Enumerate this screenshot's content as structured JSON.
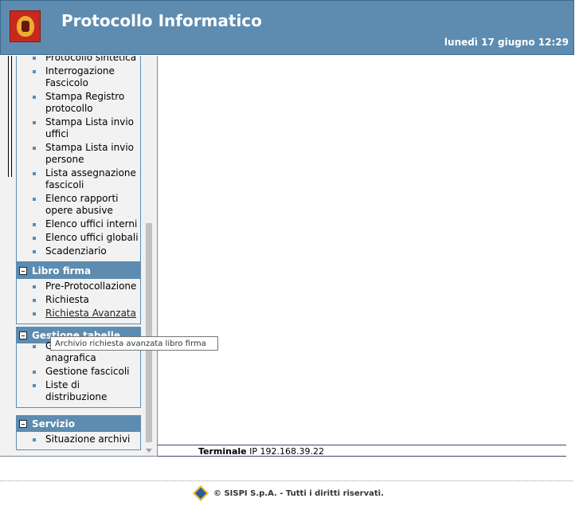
{
  "header": {
    "title": "Protocollo Informatico",
    "datetime": "lunedì 17 giugno 12:29"
  },
  "sidebar": {
    "sections": [
      {
        "title": "",
        "items": [
          {
            "label": "Protocollo sintetica"
          },
          {
            "label": "Interrogazione Fascicolo"
          },
          {
            "label": "Stampa Registro protocollo"
          },
          {
            "label": "Stampa Lista invio uffici"
          },
          {
            "label": "Stampa Lista invio persone"
          },
          {
            "label": "Lista assegnazione fascicoli"
          },
          {
            "label": "Elenco rapporti opere abusive"
          },
          {
            "label": "Elenco uffici interni"
          },
          {
            "label": "Elenco uffici globali"
          },
          {
            "label": "Scadenziario"
          }
        ]
      },
      {
        "title": "Libro firma",
        "items": [
          {
            "label": "Pre-Protocollazione"
          },
          {
            "label": "Richiesta"
          },
          {
            "label": "Richiesta Avanzata"
          }
        ]
      },
      {
        "title": "Gestione tabelle",
        "items": [
          {
            "label": "Gestione anagrafica"
          },
          {
            "label": "Gestione fascicoli"
          },
          {
            "label": "Liste di distribuzione"
          }
        ]
      },
      {
        "title": "Servizio",
        "items": [
          {
            "label": "Situazione archivi"
          }
        ]
      }
    ]
  },
  "tooltip": {
    "text": "Archivio richiesta avanzata libro firma"
  },
  "status": {
    "terminal_label": "Terminale",
    "ip_text": "IP 192.168.39.22"
  },
  "footer": {
    "copyright": "© SISPI S.p.A. - Tutti i diritti riservati."
  },
  "colors": {
    "header_bg": "#5d8cb0",
    "section_head_bg": "#5d8cb0"
  }
}
